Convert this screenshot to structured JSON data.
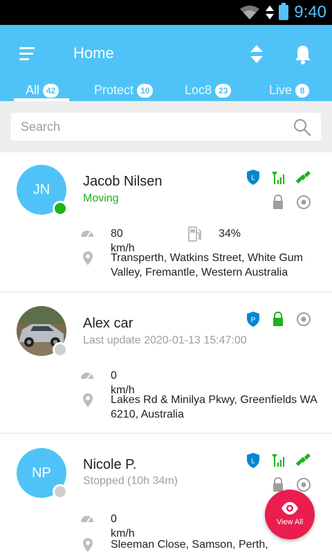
{
  "status_bar": {
    "time": "9:40"
  },
  "app_bar": {
    "title": "Home"
  },
  "tabs": [
    {
      "label": "All",
      "count": "42"
    },
    {
      "label": "Protect",
      "count": "10"
    },
    {
      "label": "Loc8",
      "count": "23"
    },
    {
      "label": "Live",
      "count": "8"
    }
  ],
  "search": {
    "placeholder": "Search"
  },
  "vehicles": [
    {
      "initials": "JN",
      "name": "Jacob Nilsen",
      "status": "Moving",
      "speed": "80 km/h",
      "fuel": "34%",
      "address": "Transperth, Watkins Street, White Gum Valley, Fremantle, Western Australia",
      "badge_letter": "L"
    },
    {
      "initials": "",
      "name": "Alex car",
      "status": "Last update 2020-01-13 15:47:00",
      "speed": "0 km/h",
      "address": "Lakes Rd & Minilya Pkwy, Greenfields WA 6210, Australia",
      "badge_letter": "P"
    },
    {
      "initials": "NP",
      "name": "Nicole P.",
      "status": "Stopped (10h 34m)",
      "speed": "0 km/h",
      "address": "Sleeman Close, Samson, Perth,",
      "badge_letter": "L"
    }
  ],
  "fab": {
    "label": "View All"
  },
  "colors": {
    "primary": "#4fc3f7",
    "online": "#1db316",
    "offline": "#cfcfcf",
    "fab": "#e91e4e",
    "icon_grey": "#9e9e9e"
  }
}
